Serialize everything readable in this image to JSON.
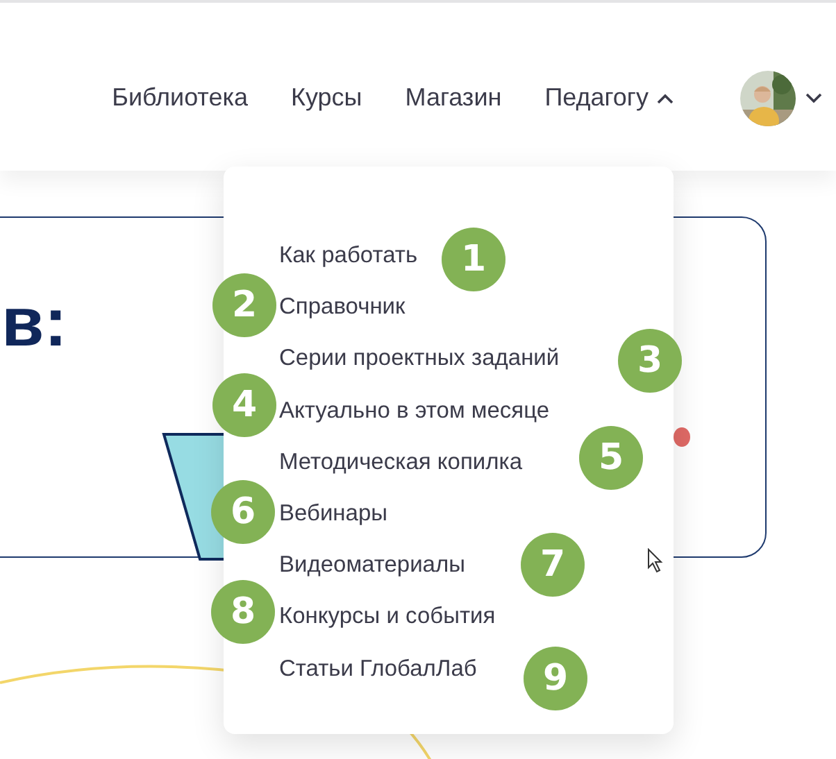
{
  "nav": [
    {
      "label": "Библиотека",
      "kind": "link"
    },
    {
      "label": "Курсы",
      "kind": "link"
    },
    {
      "label": "Магазин",
      "kind": "link"
    },
    {
      "label": "Педагогу",
      "kind": "dropdown",
      "expanded": true
    }
  ],
  "account": {
    "expanded": false
  },
  "banner": {
    "heading": "в:"
  },
  "menu": {
    "items": [
      {
        "label": "Как работать",
        "badge": "1"
      },
      {
        "label": "Справочник",
        "badge": "2"
      },
      {
        "label": "Серии проектных заданий",
        "badge": "3"
      },
      {
        "label": "Актуально в этом месяце",
        "badge": "4"
      },
      {
        "label": "Методическая копилка",
        "badge": "5"
      },
      {
        "label": "Вебинары",
        "badge": "6"
      },
      {
        "label": "Видеоматериалы",
        "badge": "7"
      },
      {
        "label": "Конкурсы и события",
        "badge": "8"
      },
      {
        "label": "Статьи ГлобалЛаб",
        "badge": "9"
      }
    ]
  }
}
